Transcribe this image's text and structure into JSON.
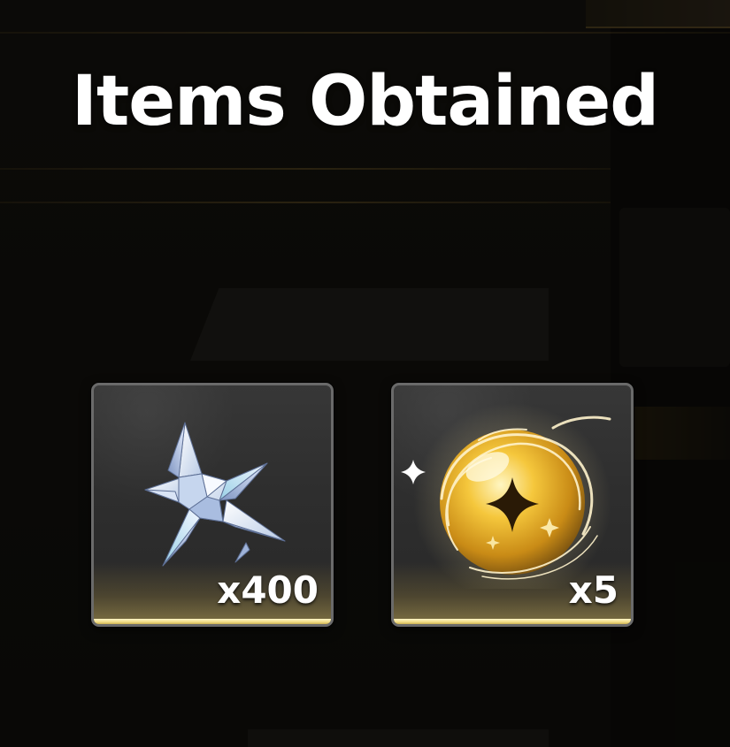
{
  "dialog": {
    "title": "Items Obtained"
  },
  "items": [
    {
      "icon": "crystal-star-icon",
      "quantity": "x400"
    },
    {
      "icon": "golden-orb-icon",
      "quantity": "x5"
    }
  ],
  "colors": {
    "title_text": "#ffffff",
    "card_border": "#6a6a6a",
    "card_gold_rule": "#f1dc84"
  }
}
